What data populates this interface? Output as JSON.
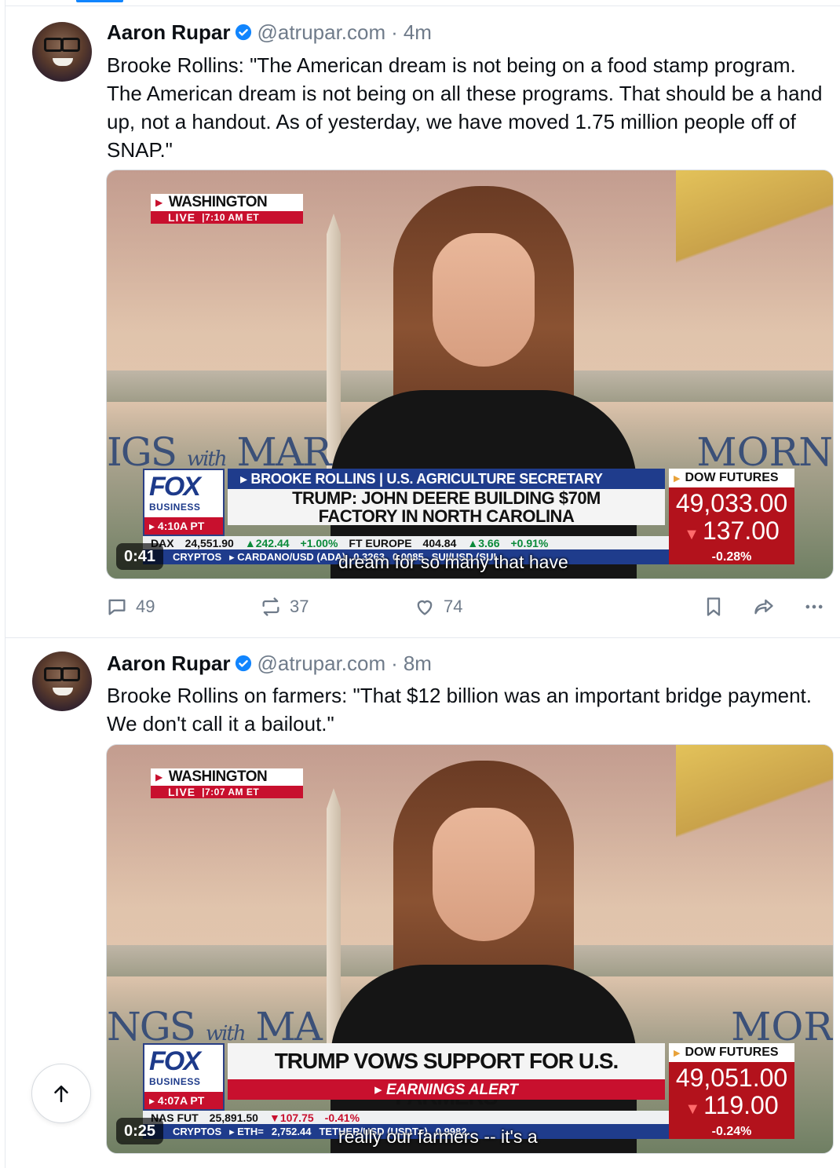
{
  "posts": [
    {
      "author": {
        "name": "Aaron Rupar",
        "handle": "@atrupar.com",
        "time": "4m",
        "avatar_icon": "avatar-photo"
      },
      "text": "Brooke Rollins: \"The American dream is not being on a food stamp program. The American dream is not being on all these programs. That should be a hand up, not a handout. As of yesterday, we have moved 1.75 million people off of SNAP.\"",
      "video": {
        "location": "WASHINGTON",
        "live_label": "LIVE",
        "live_time": "7:10 AM ET",
        "show_left": "IGS",
        "show_with": "with",
        "show_mid": "MAR",
        "show_right": "MORN",
        "fox": "FOX",
        "fox_sub": "BUSINESS",
        "clock": "▸ 4:10A PT",
        "chyron_top": "▸ BROOKE ROLLINS | U.S. AGRICULTURE SECRETARY",
        "chyron_main_1": "TRUMP: JOHN DEERE BUILDING $70M",
        "chyron_main_2": "FACTORY IN NORTH CAROLINA",
        "ticker1": [
          "DAX",
          "24,551.90",
          "▲242.44",
          "+1.00%",
          "FT EUROPE",
          "404.84",
          "▲3.66",
          "+0.91%"
        ],
        "ticker2": [
          "CRYPTOS",
          "▸ CARDANO/USD (ADA)",
          "0.3263",
          "0.0085",
          "SUI/USD (SUI"
        ],
        "dow_label": "DOW FUTURES",
        "dow_value": "49,033.00",
        "dow_change": "137.00",
        "dow_pct": "-0.28%",
        "timestamp": "0:41",
        "caption": "dream for so many that have"
      },
      "stats": {
        "replies": "49",
        "reposts": "37",
        "likes": "74"
      }
    },
    {
      "author": {
        "name": "Aaron Rupar",
        "handle": "@atrupar.com",
        "time": "8m",
        "avatar_icon": "avatar-photo"
      },
      "text": "Brooke Rollins on farmers: \"That $12 billion was an important bridge payment. We don't call it a bailout.\"",
      "video": {
        "location": "WASHINGTON",
        "live_label": "LIVE",
        "live_time": "7:07 AM ET",
        "show_left": "NGS",
        "show_with": "with",
        "show_mid": "MA",
        "show_right": "MOR",
        "fox": "FOX",
        "fox_sub": "BUSINESS",
        "clock": "▸ 4:07A PT",
        "chyron_main": "TRUMP VOWS SUPPORT FOR U.S. FARMERS",
        "chyron_alert": "▸ EARNINGS ALERT",
        "ticker1": [
          "NAS FUT",
          "25,891.50",
          "▼107.75",
          "-0.41%"
        ],
        "ticker2": [
          "CRYPTOS",
          "▸ ETH=",
          "2,752.44",
          "TETHER/USD (USDT=)",
          "0.9982"
        ],
        "dow_label": "DOW FUTURES",
        "dow_value": "49,051.00",
        "dow_change": "119.00",
        "dow_pct": "-0.24%",
        "timestamp": "0:25",
        "caption": "really our farmers -- it's a"
      }
    }
  ],
  "colors": {
    "accent": "#1185fe",
    "muted": "#6f7b8a",
    "fox_red": "#c8102e",
    "fox_blue": "#1f3c8c"
  }
}
